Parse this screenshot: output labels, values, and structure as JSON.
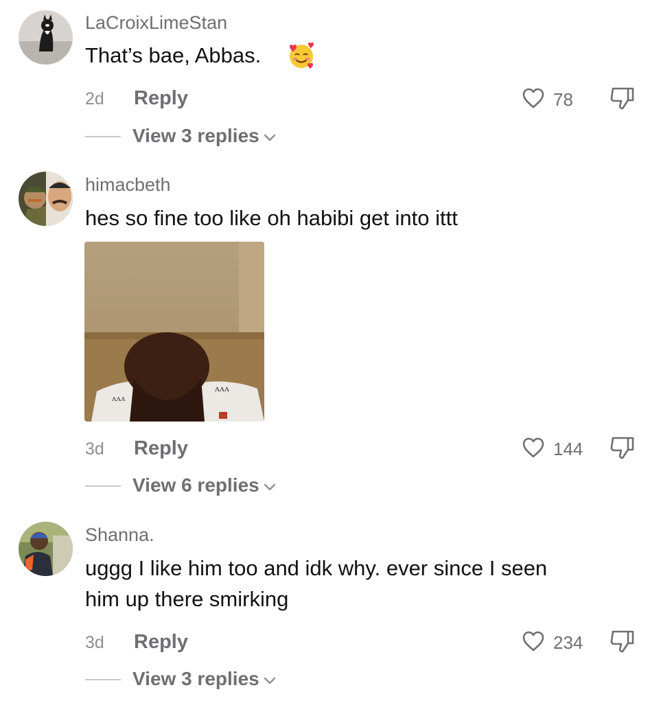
{
  "comments": [
    {
      "username": "LaCroixLimeStan",
      "text": "That’s bae, Abbas.",
      "emoji": "smiling-face-with-hearts",
      "time": "2d",
      "reply_label": "Reply",
      "likes": "78",
      "view_replies": "View 3 replies"
    },
    {
      "username": "himacbeth",
      "text": "hes so fine too like oh habibi get into ittt",
      "time": "3d",
      "reply_label": "Reply",
      "likes": "144",
      "view_replies": "View 6 replies"
    },
    {
      "username": "Shanna.",
      "text_line1": "uggg I like him too and idk why. ever since I seen",
      "text_line2": "him up there smirking",
      "time": "3d",
      "reply_label": "Reply",
      "likes": "234",
      "view_replies": "View 3 replies"
    }
  ],
  "icons": {
    "like": "heart-outline-icon",
    "dislike": "thumbs-down-outline-icon",
    "expand": "chevron-down-icon"
  },
  "colors": {
    "primary_text": "#111111",
    "secondary_text": "#6e6e73",
    "muted_text": "#8e8e93",
    "divider": "#c7c7cc"
  }
}
